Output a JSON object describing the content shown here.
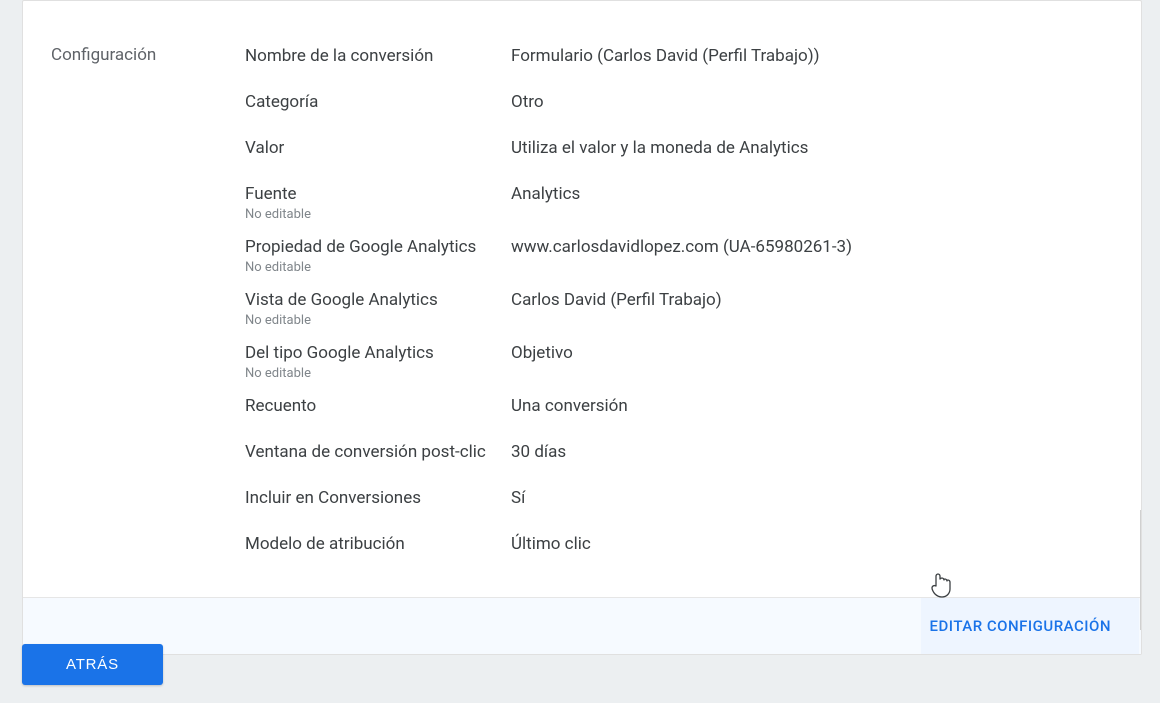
{
  "section": {
    "title": "Configuración"
  },
  "fields": {
    "name": {
      "label": "Nombre de la conversión",
      "value": "Formulario (Carlos David (Perfil Trabajo))"
    },
    "category": {
      "label": "Categoría",
      "value": "Otro"
    },
    "val": {
      "label": "Valor",
      "value": "Utiliza el valor y la moneda de Analytics"
    },
    "source": {
      "label": "Fuente",
      "sub": "No editable",
      "value": "Analytics"
    },
    "property": {
      "label": "Propiedad de Google Analytics",
      "sub": "No editable",
      "value": "www.carlosdavidlopez.com (UA-65980261-3)"
    },
    "view": {
      "label": "Vista de Google Analytics",
      "sub": "No editable",
      "value": "Carlos David (Perfil Trabajo)"
    },
    "gatype": {
      "label": "Del tipo Google Analytics",
      "sub": "No editable",
      "value": "Objetivo"
    },
    "count": {
      "label": "Recuento",
      "value": "Una conversión"
    },
    "window": {
      "label": "Ventana de conversión post-clic",
      "value": "30 días"
    },
    "include": {
      "label": "Incluir en Conversiones",
      "value": "Sí"
    },
    "attribution": {
      "label": "Modelo de atribución",
      "value": "Último clic"
    }
  },
  "actions": {
    "edit": "EDITAR CONFIGURACIÓN",
    "back": "ATRÁS"
  }
}
